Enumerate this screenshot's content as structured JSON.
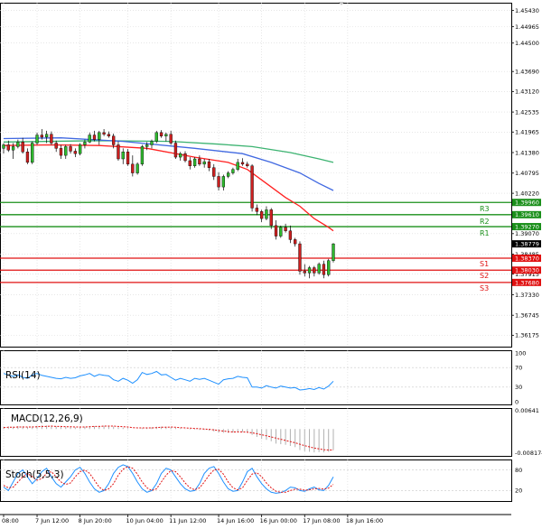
{
  "chart_data": {
    "type": "candlestick",
    "main": {
      "ylim": [
        1.3585,
        1.4565
      ],
      "y_ticks": [
        "1.45430",
        "1.44965",
        "1.44500",
        "1.43690",
        "1.43120",
        "1.42535",
        "1.41965",
        "1.41380",
        "1.40795",
        "1.40220",
        "1.39070",
        "1.38485",
        "1.37915",
        "1.37330",
        "1.36745",
        "1.36175"
      ],
      "candles": [
        {
          "o": 1.415,
          "h": 1.4165,
          "l": 1.4135,
          "c": 1.416
        },
        {
          "o": 1.416,
          "h": 1.4172,
          "l": 1.414,
          "c": 1.4145
        },
        {
          "o": 1.4145,
          "h": 1.4165,
          "l": 1.412,
          "c": 1.4155
        },
        {
          "o": 1.4155,
          "h": 1.4175,
          "l": 1.415,
          "c": 1.4168
        },
        {
          "o": 1.4168,
          "h": 1.418,
          "l": 1.4135,
          "c": 1.414
        },
        {
          "o": 1.414,
          "h": 1.415,
          "l": 1.4105,
          "c": 1.411
        },
        {
          "o": 1.411,
          "h": 1.417,
          "l": 1.4105,
          "c": 1.4165
        },
        {
          "o": 1.4165,
          "h": 1.4195,
          "l": 1.416,
          "c": 1.4188
        },
        {
          "o": 1.4188,
          "h": 1.4205,
          "l": 1.4175,
          "c": 1.4182
        },
        {
          "o": 1.4182,
          "h": 1.42,
          "l": 1.4165,
          "c": 1.419
        },
        {
          "o": 1.419,
          "h": 1.4198,
          "l": 1.416,
          "c": 1.4165
        },
        {
          "o": 1.4165,
          "h": 1.4172,
          "l": 1.414,
          "c": 1.415
        },
        {
          "o": 1.415,
          "h": 1.416,
          "l": 1.412,
          "c": 1.413
        },
        {
          "o": 1.413,
          "h": 1.416,
          "l": 1.412,
          "c": 1.4155
        },
        {
          "o": 1.4155,
          "h": 1.4162,
          "l": 1.4135,
          "c": 1.4142
        },
        {
          "o": 1.4142,
          "h": 1.415,
          "l": 1.4125,
          "c": 1.4135
        },
        {
          "o": 1.4135,
          "h": 1.4165,
          "l": 1.413,
          "c": 1.416
        },
        {
          "o": 1.416,
          "h": 1.4175,
          "l": 1.415,
          "c": 1.4168
        },
        {
          "o": 1.4168,
          "h": 1.4195,
          "l": 1.4165,
          "c": 1.4188
        },
        {
          "o": 1.4188,
          "h": 1.42,
          "l": 1.417,
          "c": 1.4175
        },
        {
          "o": 1.4175,
          "h": 1.42,
          "l": 1.416,
          "c": 1.4195
        },
        {
          "o": 1.4195,
          "h": 1.4205,
          "l": 1.4185,
          "c": 1.419
        },
        {
          "o": 1.419,
          "h": 1.4198,
          "l": 1.418,
          "c": 1.4185
        },
        {
          "o": 1.4185,
          "h": 1.4192,
          "l": 1.415,
          "c": 1.416
        },
        {
          "o": 1.416,
          "h": 1.417,
          "l": 1.4115,
          "c": 1.412
        },
        {
          "o": 1.412,
          "h": 1.415,
          "l": 1.4105,
          "c": 1.414
        },
        {
          "o": 1.414,
          "h": 1.4148,
          "l": 1.41,
          "c": 1.4105
        },
        {
          "o": 1.4105,
          "h": 1.413,
          "l": 1.407,
          "c": 1.408
        },
        {
          "o": 1.408,
          "h": 1.411,
          "l": 1.4075,
          "c": 1.4105
        },
        {
          "o": 1.4105,
          "h": 1.416,
          "l": 1.41,
          "c": 1.4155
        },
        {
          "o": 1.4155,
          "h": 1.4168,
          "l": 1.4145,
          "c": 1.416
        },
        {
          "o": 1.416,
          "h": 1.4175,
          "l": 1.415,
          "c": 1.417
        },
        {
          "o": 1.417,
          "h": 1.42,
          "l": 1.4165,
          "c": 1.4195
        },
        {
          "o": 1.4195,
          "h": 1.4202,
          "l": 1.418,
          "c": 1.4185
        },
        {
          "o": 1.4185,
          "h": 1.4195,
          "l": 1.417,
          "c": 1.419
        },
        {
          "o": 1.419,
          "h": 1.42,
          "l": 1.416,
          "c": 1.4165
        },
        {
          "o": 1.4165,
          "h": 1.4172,
          "l": 1.412,
          "c": 1.4125
        },
        {
          "o": 1.4125,
          "h": 1.414,
          "l": 1.4115,
          "c": 1.4135
        },
        {
          "o": 1.4135,
          "h": 1.4142,
          "l": 1.411,
          "c": 1.4115
        },
        {
          "o": 1.4115,
          "h": 1.4125,
          "l": 1.409,
          "c": 1.41
        },
        {
          "o": 1.41,
          "h": 1.4125,
          "l": 1.4095,
          "c": 1.412
        },
        {
          "o": 1.412,
          "h": 1.413,
          "l": 1.41,
          "c": 1.4105
        },
        {
          "o": 1.4105,
          "h": 1.412,
          "l": 1.4095,
          "c": 1.4112
        },
        {
          "o": 1.4112,
          "h": 1.412,
          "l": 1.4085,
          "c": 1.4095
        },
        {
          "o": 1.4095,
          "h": 1.4105,
          "l": 1.406,
          "c": 1.407
        },
        {
          "o": 1.407,
          "h": 1.4082,
          "l": 1.403,
          "c": 1.404
        },
        {
          "o": 1.404,
          "h": 1.4075,
          "l": 1.403,
          "c": 1.407
        },
        {
          "o": 1.407,
          "h": 1.4085,
          "l": 1.4065,
          "c": 1.408
        },
        {
          "o": 1.408,
          "h": 1.4095,
          "l": 1.4075,
          "c": 1.409
        },
        {
          "o": 1.409,
          "h": 1.412,
          "l": 1.4085,
          "c": 1.411
        },
        {
          "o": 1.411,
          "h": 1.4122,
          "l": 1.41,
          "c": 1.4105
        },
        {
          "o": 1.4105,
          "h": 1.4112,
          "l": 1.4095,
          "c": 1.41
        },
        {
          "o": 1.41,
          "h": 1.4105,
          "l": 1.397,
          "c": 1.398
        },
        {
          "o": 1.398,
          "h": 1.399,
          "l": 1.396,
          "c": 1.397
        },
        {
          "o": 1.397,
          "h": 1.3975,
          "l": 1.394,
          "c": 1.395
        },
        {
          "o": 1.395,
          "h": 1.3985,
          "l": 1.3945,
          "c": 1.3975
        },
        {
          "o": 1.3975,
          "h": 1.398,
          "l": 1.392,
          "c": 1.393
        },
        {
          "o": 1.393,
          "h": 1.3945,
          "l": 1.389,
          "c": 1.39
        },
        {
          "o": 1.39,
          "h": 1.393,
          "l": 1.3895,
          "c": 1.3925
        },
        {
          "o": 1.3925,
          "h": 1.3935,
          "l": 1.391,
          "c": 1.3915
        },
        {
          "o": 1.3915,
          "h": 1.393,
          "l": 1.388,
          "c": 1.389
        },
        {
          "o": 1.389,
          "h": 1.3895,
          "l": 1.387,
          "c": 1.3878
        },
        {
          "o": 1.3878,
          "h": 1.3885,
          "l": 1.379,
          "c": 1.38
        },
        {
          "o": 1.38,
          "h": 1.382,
          "l": 1.3785,
          "c": 1.3795
        },
        {
          "o": 1.3795,
          "h": 1.3815,
          "l": 1.378,
          "c": 1.381
        },
        {
          "o": 1.381,
          "h": 1.3815,
          "l": 1.3785,
          "c": 1.3795
        },
        {
          "o": 1.3795,
          "h": 1.3825,
          "l": 1.379,
          "c": 1.382
        },
        {
          "o": 1.382,
          "h": 1.383,
          "l": 1.378,
          "c": 1.379
        },
        {
          "o": 1.379,
          "h": 1.3835,
          "l": 1.3785,
          "c": 1.383
        },
        {
          "o": 1.383,
          "h": 1.388,
          "l": 1.3825,
          "c": 1.38779
        }
      ],
      "current_price": "1.38779",
      "levels": [
        {
          "name": "R3",
          "value": 1.3996,
          "label": "1.39960",
          "color": "#1a8f1a"
        },
        {
          "name": "R2",
          "value": 1.3961,
          "label": "1.39610",
          "color": "#1a8f1a"
        },
        {
          "name": "R1",
          "value": 1.3927,
          "label": "1.39270",
          "color": "#1a8f1a"
        },
        {
          "name": "S1",
          "value": 1.3837,
          "label": "1.38370",
          "color": "#e01010"
        },
        {
          "name": "S2",
          "value": 1.3803,
          "label": "1.38030",
          "color": "#e01010"
        },
        {
          "name": "S3",
          "value": 1.3768,
          "label": "1.37680",
          "color": "#e01010"
        }
      ],
      "moving_averages": [
        {
          "color": "#3cb371",
          "points": [
            [
              0,
              1.4168
            ],
            [
              20,
              1.4172
            ],
            [
              35,
              1.417
            ],
            [
              45,
              1.4162
            ],
            [
              52,
              1.4155
            ],
            [
              60,
              1.4138
            ],
            [
              66,
              1.412
            ],
            [
              69,
              1.411
            ]
          ]
        },
        {
          "color": "#4169e1",
          "points": [
            [
              0,
              1.4178
            ],
            [
              12,
              1.418
            ],
            [
              25,
              1.417
            ],
            [
              40,
              1.415
            ],
            [
              50,
              1.4135
            ],
            [
              56,
              1.411
            ],
            [
              62,
              1.408
            ],
            [
              66,
              1.405
            ],
            [
              69,
              1.403
            ]
          ]
        },
        {
          "color": "#ff2020",
          "points": [
            [
              0,
              1.4158
            ],
            [
              10,
              1.416
            ],
            [
              20,
              1.4158
            ],
            [
              30,
              1.415
            ],
            [
              40,
              1.4125
            ],
            [
              47,
              1.411
            ],
            [
              51,
              1.409
            ],
            [
              55,
              1.405
            ],
            [
              59,
              1.401
            ],
            [
              62,
              1.3985
            ],
            [
              65,
              1.395
            ],
            [
              68,
              1.3925
            ],
            [
              69,
              1.3915
            ]
          ]
        }
      ]
    },
    "x_labels": [
      {
        "i": 0,
        "label": "08:00"
      },
      {
        "i": 7,
        "label": "7 Jun 12:00"
      },
      {
        "i": 16,
        "label": "8 Jun 20:00"
      },
      {
        "i": 26,
        "label": "10 Jun 04:00"
      },
      {
        "i": 35,
        "label": "11 Jun 12:00"
      },
      {
        "i": 45,
        "label": "14 Jun 16:00"
      },
      {
        "i": 54,
        "label": "16 Jun 00:00"
      },
      {
        "i": 63,
        "label": "17 Jun 08:00"
      },
      {
        "i": 72,
        "label": "18 Jun 16:00"
      }
    ],
    "rsi": {
      "label": "RSI(14)",
      "ylim": [
        0,
        100
      ],
      "ticks": [
        "100",
        "70",
        "30",
        "0"
      ],
      "color": "#1e90ff",
      "values": [
        58,
        55,
        52,
        55,
        50,
        48,
        55,
        58,
        54,
        52,
        50,
        48,
        47,
        50,
        48,
        49,
        53,
        55,
        58,
        52,
        56,
        54,
        53,
        45,
        42,
        48,
        44,
        38,
        45,
        60,
        56,
        58,
        62,
        55,
        56,
        50,
        44,
        48,
        45,
        42,
        48,
        46,
        48,
        44,
        40,
        36,
        45,
        47,
        48,
        52,
        50,
        49,
        30,
        30,
        28,
        33,
        30,
        28,
        32,
        30,
        28,
        29,
        24,
        25,
        27,
        25,
        29,
        26,
        32,
        42
      ]
    },
    "macd": {
      "label": "MACD(12,26,9)",
      "ylim": [
        -0.0092,
        0.0072
      ],
      "ticks": [
        "0.00641",
        "-0.008174"
      ],
      "hist_color": "#b0b0b0",
      "signal_color": "#e01010",
      "hist": [
        0.0008,
        0.0009,
        0.0008,
        0.001,
        0.0009,
        0.0007,
        0.0009,
        0.0011,
        0.0012,
        0.0012,
        0.0011,
        0.0009,
        0.0008,
        0.0008,
        0.0007,
        0.0006,
        0.0007,
        0.0008,
        0.001,
        0.001,
        0.0011,
        0.0011,
        0.0011,
        0.0009,
        0.0006,
        0.0005,
        0.0003,
        0.0,
        0.0,
        0.0003,
        0.0005,
        0.0006,
        0.0008,
        0.0008,
        0.0008,
        0.0007,
        0.0004,
        0.0003,
        0.0001,
        -0.0002,
        -0.0002,
        -0.0003,
        -0.0003,
        -0.0005,
        -0.0008,
        -0.0012,
        -0.0013,
        -0.0013,
        -0.0012,
        -0.001,
        -0.001,
        -0.0011,
        -0.002,
        -0.0027,
        -0.0034,
        -0.0037,
        -0.0042,
        -0.005,
        -0.0052,
        -0.0054,
        -0.0058,
        -0.0062,
        -0.0072,
        -0.0076,
        -0.0078,
        -0.008,
        -0.0079,
        -0.008,
        -0.0078,
        -0.0072
      ],
      "signal": [
        0.0005,
        0.0006,
        0.0006,
        0.0007,
        0.0007,
        0.0007,
        0.0007,
        0.0008,
        0.0009,
        0.0009,
        0.001,
        0.0009,
        0.0009,
        0.0008,
        0.0008,
        0.0007,
        0.0007,
        0.0007,
        0.0008,
        0.0009,
        0.0009,
        0.001,
        0.001,
        0.001,
        0.0009,
        0.0008,
        0.0007,
        0.0005,
        0.0004,
        0.0004,
        0.0004,
        0.0004,
        0.0005,
        0.0006,
        0.0006,
        0.0007,
        0.0006,
        0.0005,
        0.0004,
        0.0003,
        0.0002,
        0.0001,
        0.0,
        -0.0001,
        -0.0003,
        -0.0005,
        -0.0007,
        -0.0009,
        -0.001,
        -0.001,
        -0.001,
        -0.0011,
        -0.0013,
        -0.0016,
        -0.002,
        -0.0023,
        -0.0027,
        -0.0031,
        -0.0035,
        -0.0039,
        -0.0043,
        -0.0047,
        -0.0052,
        -0.0057,
        -0.0061,
        -0.0065,
        -0.0068,
        -0.0071,
        -0.0072,
        -0.0072
      ]
    },
    "stoch": {
      "label": "Stoch(5,5,3)",
      "ylim": [
        0,
        100
      ],
      "ticks": [
        "80",
        "20"
      ],
      "main_color": "#1e90ff",
      "signal_color": "#e01010",
      "main": [
        30,
        20,
        45,
        70,
        80,
        60,
        40,
        55,
        75,
        85,
        60,
        40,
        30,
        45,
        60,
        80,
        88,
        70,
        45,
        25,
        15,
        20,
        40,
        70,
        88,
        95,
        90,
        70,
        45,
        25,
        15,
        20,
        40,
        70,
        85,
        80,
        60,
        40,
        25,
        18,
        20,
        40,
        70,
        85,
        90,
        70,
        45,
        25,
        18,
        20,
        45,
        75,
        85,
        60,
        40,
        25,
        15,
        12,
        14,
        20,
        30,
        28,
        20,
        18,
        25,
        30,
        22,
        20,
        35,
        60
      ],
      "signal": [
        35,
        28,
        30,
        45,
        60,
        70,
        60,
        50,
        55,
        70,
        75,
        60,
        45,
        38,
        42,
        60,
        75,
        80,
        70,
        50,
        30,
        20,
        25,
        40,
        65,
        82,
        90,
        85,
        68,
        45,
        28,
        20,
        25,
        45,
        65,
        78,
        75,
        60,
        42,
        28,
        22,
        28,
        45,
        65,
        80,
        82,
        68,
        45,
        28,
        22,
        28,
        50,
        68,
        72,
        60,
        42,
        28,
        18,
        15,
        15,
        20,
        24,
        24,
        21,
        22,
        25,
        26,
        24,
        27,
        38
      ]
    }
  }
}
